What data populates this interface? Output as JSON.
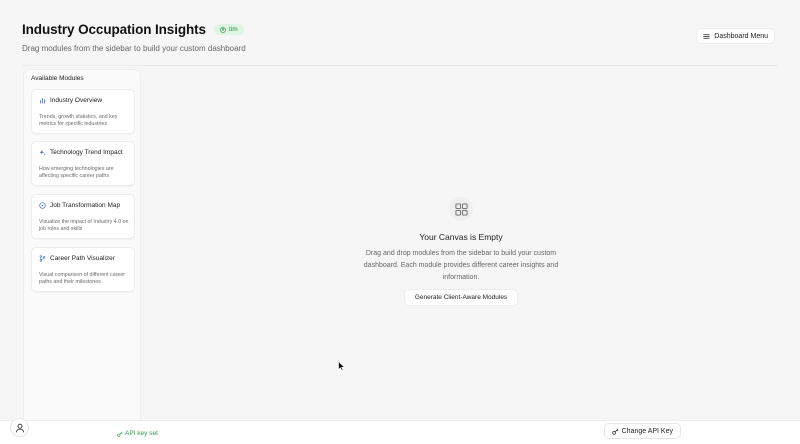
{
  "header": {
    "title": "Industry Occupation Insights",
    "user_badge": "tim",
    "subtitle": "Drag modules from the sidebar to build your custom dashboard"
  },
  "menu_button": {
    "label": "Dashboard Menu",
    "icon": "hamburger-icon"
  },
  "sidebar": {
    "heading": "Available Modules",
    "modules": [
      {
        "title": "Industry Overview",
        "icon": "bar-chart-icon",
        "description": "Trends, growth statistics, and key metrics for specific industries"
      },
      {
        "title": "Technology Trend Impact",
        "icon": "sparkles-icon",
        "description": "How emerging technologies are affecting specific career paths"
      },
      {
        "title": "Job Transformation Map",
        "icon": "compass-icon",
        "description": "Visualize the impact of Industry 4.0 on job roles and skills"
      },
      {
        "title": "Career Path Visualizer",
        "icon": "git-branch-icon",
        "description": "Visual comparison of different career paths and their milestones"
      }
    ]
  },
  "canvas": {
    "icon": "grid-icon",
    "empty_title": "Your Canvas is Empty",
    "empty_description": "Drag and drop modules from the sidebar to build your custom dashboard. Each module provides different career insights and information.",
    "generate_label": "Generate Client-Aware Modules"
  },
  "footer": {
    "api_status": "API key set",
    "change_key_label": "Change API Key"
  },
  "colors": {
    "accent_green": "#2f9a4a",
    "badge_bg": "#dff5e3",
    "background": "#f6f6f7"
  }
}
